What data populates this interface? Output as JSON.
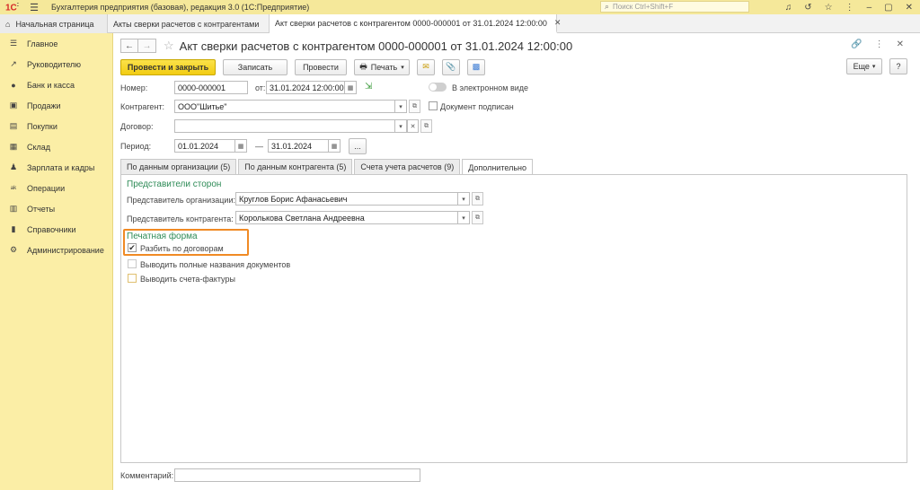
{
  "titlebar": {
    "logo": "1С",
    "title": "Бухгалтерия предприятия (базовая), редакция 3.0  (1С:Предприятие)",
    "search_placeholder": "Поиск Ctrl+Shift+F"
  },
  "tabs": [
    {
      "label": "Начальная страница"
    },
    {
      "label": "Акты сверки расчетов с контрагентами"
    },
    {
      "label": "Акт сверки расчетов с контрагентом 0000-000001 от 31.01.2024 12:00:00"
    }
  ],
  "sidebar": {
    "items": [
      {
        "label": "Главное",
        "icon": "menu-icon"
      },
      {
        "label": "Руководителю",
        "icon": "trend-icon"
      },
      {
        "label": "Банк и касса",
        "icon": "coin-icon"
      },
      {
        "label": "Продажи",
        "icon": "cart-icon"
      },
      {
        "label": "Покупки",
        "icon": "basket-icon"
      },
      {
        "label": "Склад",
        "icon": "warehouse-icon"
      },
      {
        "label": "Зарплата и кадры",
        "icon": "person-icon"
      },
      {
        "label": "Операции",
        "icon": "operations-icon"
      },
      {
        "label": "Отчеты",
        "icon": "chart-icon"
      },
      {
        "label": "Справочники",
        "icon": "book-icon"
      },
      {
        "label": "Администрирование",
        "icon": "gear-icon"
      }
    ]
  },
  "document": {
    "title": "Акт сверки расчетов с контрагентом 0000-000001 от 31.01.2024 12:00:00"
  },
  "toolbar": {
    "post_close": "Провести и закрыть",
    "save": "Записать",
    "post": "Провести",
    "print": "Печать",
    "more": "Еще",
    "help": "?"
  },
  "form": {
    "number_label": "Номер:",
    "number_value": "0000-000001",
    "date_label": "от:",
    "date_value": "31.01.2024 12:00:00",
    "electronic_label": "В электронном виде",
    "counterparty_label": "Контрагент:",
    "counterparty_value": "ООО\"Шитье\"",
    "signed_label": "Документ подписан",
    "contract_label": "Договор:",
    "contract_value": "",
    "period_label": "Период:",
    "period_from": "01.01.2024",
    "period_dash": "—",
    "period_to": "31.01.2024",
    "period_more": "..."
  },
  "panel_tabs": [
    {
      "label": "По данным организации (5)"
    },
    {
      "label": "По данным контрагента (5)"
    },
    {
      "label": "Счета учета расчетов (9)"
    },
    {
      "label": "Дополнительно"
    }
  ],
  "additional": {
    "reps_header": "Представители сторон",
    "org_rep_label": "Представитель организации:",
    "org_rep_value": "Круглов Борис Афанасьевич",
    "cp_rep_label": "Представитель контрагента:",
    "cp_rep_value": "Королькова Светлана Андреевна",
    "print_header": "Печатная форма",
    "split_contracts": "Разбить по договорам",
    "full_names": "Выводить полные названия документов",
    "invoices": "Выводить счета-фактуры"
  },
  "footer": {
    "comment_label": "Комментарий:",
    "comment_value": ""
  }
}
